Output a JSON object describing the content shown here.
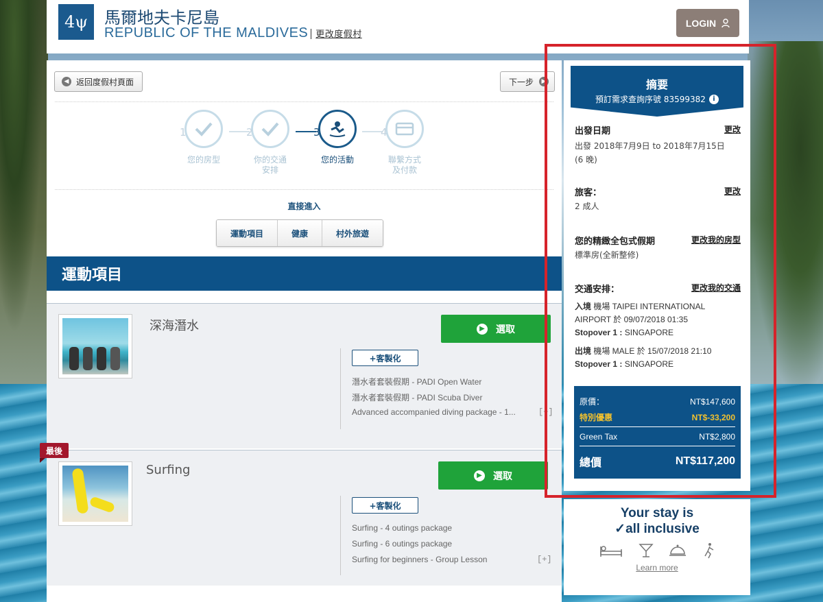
{
  "header": {
    "logo_text": "4ψ",
    "resort_name_cn": "馬爾地夫卡尼島",
    "resort_name_en": "REPUBLIC OF THE MALDIVES",
    "change_resort": "更改度假村",
    "login_label": "LOGIN"
  },
  "nav": {
    "back_label": "返回度假村頁面",
    "next_label": "下一步"
  },
  "steps": [
    {
      "num": "1",
      "label": "您的房型",
      "state": "done"
    },
    {
      "num": "2",
      "label": "你的交通\n安排",
      "state": "done"
    },
    {
      "num": "3",
      "label": "您的活動",
      "state": "active"
    },
    {
      "num": "4",
      "label": "聯繫方式\n及付款",
      "state": "pending"
    }
  ],
  "direct": {
    "title": "直接進入",
    "tabs": [
      "運動項目",
      "健康",
      "村外旅遊"
    ]
  },
  "section_title": "運動項目",
  "activities": [
    {
      "name": "深海潛水",
      "select_label": "選取",
      "customize_label": "+客製化",
      "options": [
        "潛水者套裝假期 - PADI Open Water",
        "潛水者套裝假期 - PADI Scuba Diver",
        "Advanced accompanied diving package - 1..."
      ],
      "expand": "[+]"
    },
    {
      "badge": "最後",
      "name": "Surfing",
      "select_label": "選取",
      "customize_label": "+客製化",
      "options": [
        "Surfing - 4 outings package",
        "Surfing - 6 outings package",
        "Surfing for beginners - Group Lesson"
      ],
      "expand": "[+]"
    }
  ],
  "summary": {
    "title": "摘要",
    "ref_label": "預訂需求查詢序號 83599382",
    "departure": {
      "label": "出發日期",
      "change": "更改",
      "text": "出發 2018年7月9日 to 2018年7月15日",
      "nights": "(6 晚)"
    },
    "travelers": {
      "label": "旅客：",
      "change": "更改",
      "text": "2 成人"
    },
    "package": {
      "label": "您的精緻全包式假期",
      "change": "更改我的房型",
      "text": "標準房(全新整修)"
    },
    "transport": {
      "label": "交通安排：",
      "change": "更改我的交通",
      "inbound_label": "入境",
      "inbound_text": " 機場 TAIPEI INTERNATIONAL AIRPORT 於 09/07/2018 01:35",
      "inbound_stop_label": "Stopover 1 :",
      "inbound_stop": " SINGAPORE",
      "outbound_label": "出境",
      "outbound_text": " 機場 MALE 於 15/07/2018 21:10",
      "outbound_stop_label": "Stopover 1 :",
      "outbound_stop": " SINGAPORE"
    },
    "prices": {
      "original_label": "原價：",
      "original_value": "NT$147,600",
      "discount_label": "特別優惠",
      "discount_value": "NT$-33,200",
      "tax_label": "Green Tax",
      "tax_value": "NT$2,800",
      "total_label": "總價",
      "total_value": "NT$117,200"
    }
  },
  "inclusive": {
    "line1": "Your stay is",
    "line2": "✓all inclusive",
    "learn_more": "Learn more"
  },
  "colors": {
    "brand_blue": "#0d5288",
    "select_green": "#1fa33a",
    "highlight_red": "#d6232b",
    "badge_red": "#a3172c",
    "discount_gold": "#f2c12e"
  }
}
